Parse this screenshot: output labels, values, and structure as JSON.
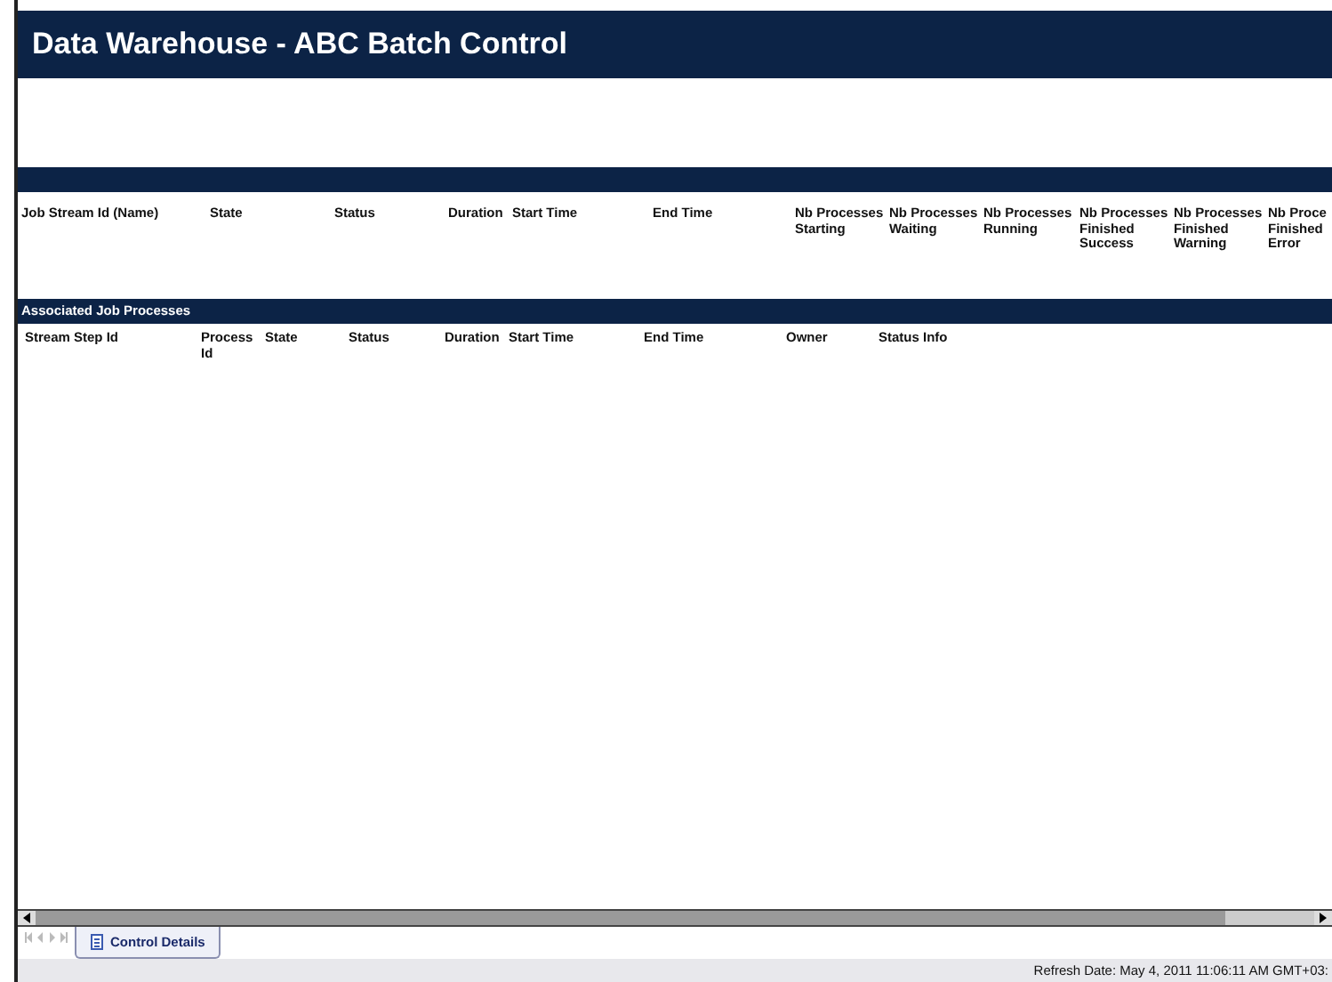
{
  "window": {
    "title": "Data Warehouse - ABC Batch Control"
  },
  "job_streams": {
    "columns": [
      "Job Stream Id (Name)",
      "State",
      "Status",
      "Duration",
      "Start Time",
      "End Time",
      "Nb Processes Starting",
      "Nb Processes Waiting",
      "Nb Processes Running",
      "Nb Processes Finished Success",
      "Nb Processes Finished Warning",
      "Nb Proce Finished Error"
    ]
  },
  "job_processes": {
    "title": "Associated Job Processes",
    "columns": [
      "Stream Step Id",
      "Process Id",
      "State",
      "Status",
      "Duration",
      "Start Time",
      "End Time",
      "Owner",
      "Status Info"
    ]
  },
  "sheet_tabs": [
    {
      "label": "Control Details",
      "selected": true
    }
  ],
  "status_bar": {
    "text": "Refresh Date: May 4, 2011 11:06:11 AM GMT+03:"
  }
}
